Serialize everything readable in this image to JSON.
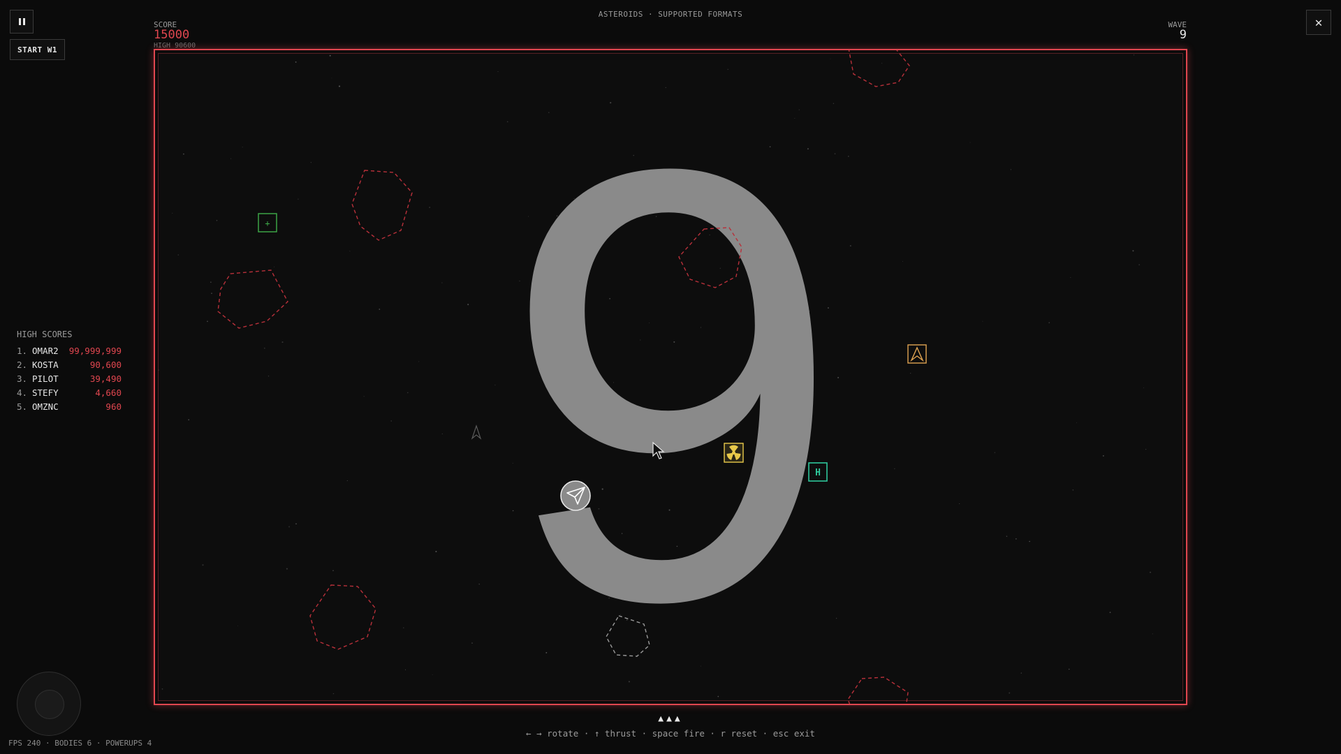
{
  "header": {
    "title": "ASTEROIDS · SUPPORTED FORMATS",
    "start_label": "START W1",
    "close_glyph": "✕"
  },
  "score": {
    "label": "SCORE",
    "value": "15000",
    "high": "HIGH 90600"
  },
  "wave": {
    "label": "WAVE",
    "value": "9",
    "big": "9"
  },
  "high_scores": {
    "title": "HIGH SCORES",
    "entries": [
      {
        "rank": "1.",
        "name": "OMAR2",
        "score": "99,999,999"
      },
      {
        "rank": "2.",
        "name": "KOSTA",
        "score": "90,600"
      },
      {
        "rank": "3.",
        "name": "PILOT",
        "score": "39,490"
      },
      {
        "rank": "4.",
        "name": "STEFY",
        "score": "4,660"
      },
      {
        "rank": "5.",
        "name": "OMZNC",
        "score": "960"
      }
    ]
  },
  "powerups": {
    "shield": "+",
    "health": "H"
  },
  "footer": {
    "lives": "▲▲▲",
    "controls": "← → rotate · ↑ thrust · space fire · r reset · esc exit",
    "stats": "FPS 240 · BODIES 6 · POWERUPS 4"
  },
  "colors": {
    "accent": "#e0464f",
    "asteroid": "#b8303a",
    "asteroid_gray": "#9a9a9a",
    "shield_powerup": "#3fae4a",
    "health_powerup": "#2ec69a",
    "nuke_powerup": "#e8c94a",
    "ship_powerup": "#e0a452"
  },
  "icons": {
    "pause": "pause-icon",
    "close": "close-icon",
    "player_ship": "paper-plane-icon",
    "cursor": "pointer-cursor-icon",
    "nuke": "radiation-icon",
    "ship_upgrade": "ship-icon"
  }
}
